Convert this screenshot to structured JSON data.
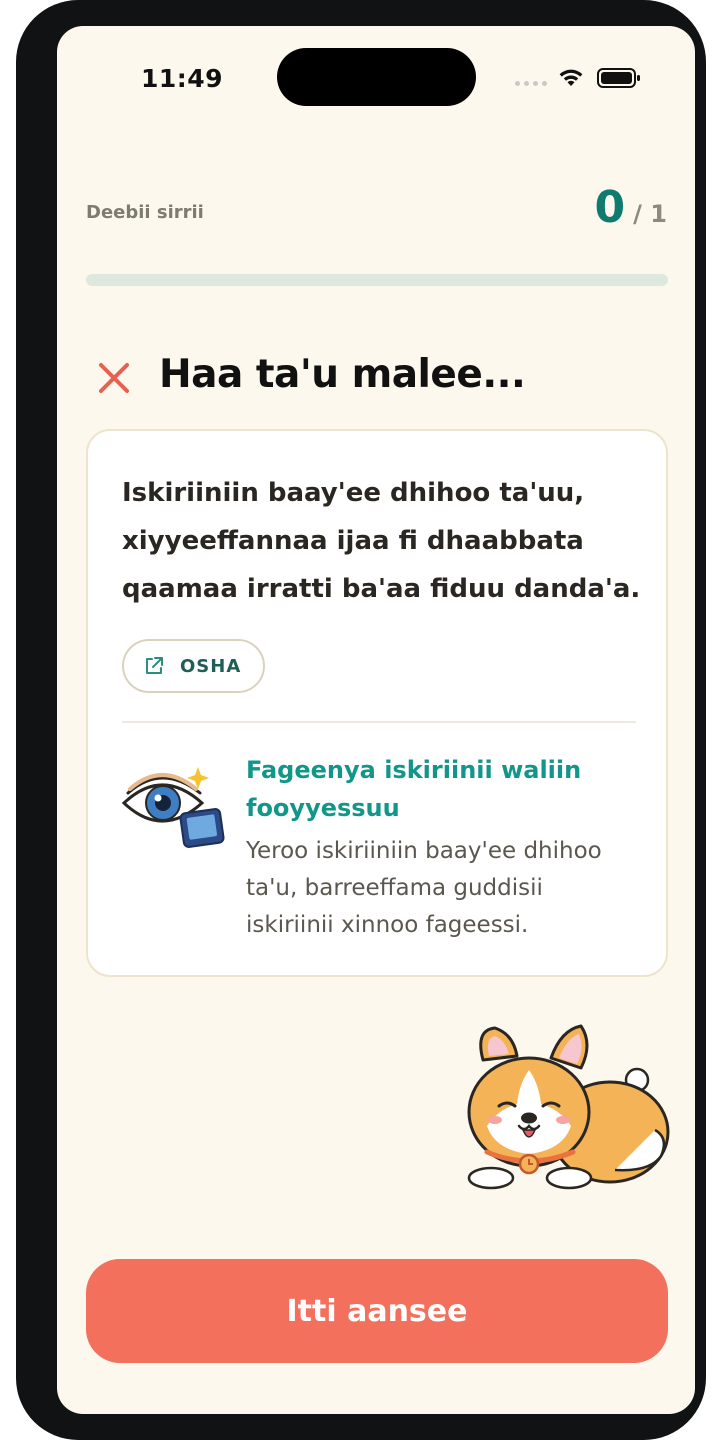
{
  "status_bar": {
    "time": "11:49"
  },
  "header": {
    "label": "Deebii sirrii",
    "score_current": "0",
    "score_total": "/ 1",
    "progress_fraction": 0
  },
  "result": {
    "icon": "close-icon",
    "title": "Haa ta'u malee..."
  },
  "card": {
    "explanation": "Iskiriiniin baay'ee dhihoo ta'uu, xiyyeeffannaa ijaa fi dhaabbata qaamaa irratti ba'aa fiduu danda'a.",
    "source_label": "OSHA",
    "source_icon": "external-link-icon",
    "tip_title": "Fageenya iskiriinii waliin fooyyessuu",
    "tip_body": "Yeroo iskiriiniin baay'ee dhihoo ta'u, barreeffama guddisii iskiriinii xinnoo fageessi."
  },
  "cta": {
    "label": "Itti aansee"
  },
  "colors": {
    "background": "#fdf8ee",
    "accent_teal": "#0f7b6e",
    "tip_teal": "#13968a",
    "cta_coral": "#f2705c",
    "wrong_red": "#e8604f"
  }
}
